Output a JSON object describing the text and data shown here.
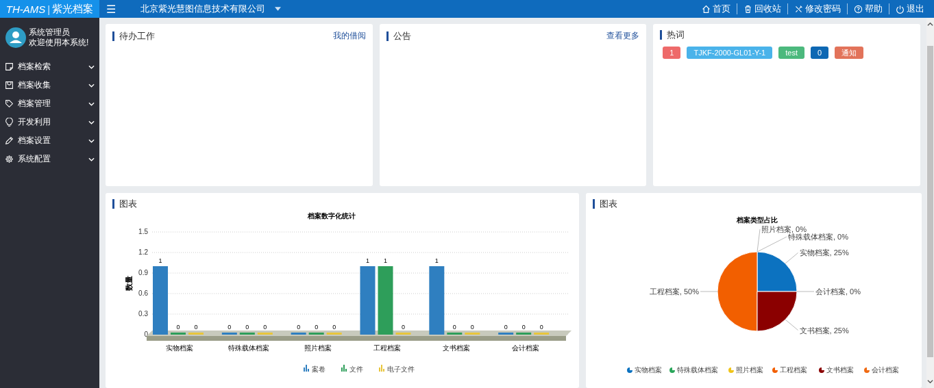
{
  "header": {
    "logo_latin": "TH-AMS",
    "logo_separator": "|",
    "logo_cn": "紫光档案",
    "menu_icon": "☰",
    "organization": "北京紫光慧图信息技术有限公司",
    "nav": [
      {
        "label": "首页"
      },
      {
        "label": "回收站"
      },
      {
        "label": "修改密码"
      },
      {
        "label": "帮助"
      },
      {
        "label": "退出"
      }
    ]
  },
  "sidebar": {
    "user": {
      "name": "系统管理员",
      "greeting": "欢迎使用本系统!"
    },
    "items": [
      {
        "label": "档案检索",
        "expanded": false
      },
      {
        "label": "档案收集",
        "expanded": false
      },
      {
        "label": "档案管理",
        "expanded": false
      },
      {
        "label": "开发利用",
        "expanded": false
      },
      {
        "label": "档案设置",
        "expanded": false
      },
      {
        "label": "系统配置",
        "expanded": false
      }
    ]
  },
  "panels": [
    {
      "title": "待办工作",
      "link": "我的借阅"
    },
    {
      "title": "公告",
      "link": "查看更多"
    },
    {
      "title": "热词",
      "tags": [
        {
          "label": "1",
          "color": "#ee6a6a"
        },
        {
          "label": "TJKF-2000-GL01-Y-1",
          "color": "#4ab3ea"
        },
        {
          "label": "test",
          "color": "#4cb97d"
        },
        {
          "label": "0",
          "color": "#0e68b3"
        },
        {
          "label": "通知",
          "color": "#e2735a"
        }
      ]
    }
  ],
  "bar_panel": {
    "title": "图表",
    "chart_data": {
      "type": "bar",
      "title": "档案数字化统计",
      "ylabel": "数量",
      "categories": [
        "实物档案",
        "特殊载体档案",
        "照片档案",
        "工程档案",
        "文书档案",
        "会计档案"
      ],
      "series": [
        {
          "name": "案卷",
          "color": "#2f7fc0",
          "values": [
            1,
            0,
            0,
            1,
            1,
            0
          ]
        },
        {
          "name": "文件",
          "color": "#2e9e5a",
          "values": [
            0,
            0,
            0,
            1,
            0,
            0
          ]
        },
        {
          "name": "电子文件",
          "color": "#e8c53a",
          "values": [
            0,
            0,
            0,
            0,
            0,
            0
          ]
        }
      ],
      "ylim": [
        0,
        1.5
      ],
      "yticks": [
        0,
        0.3,
        0.6,
        0.9,
        1.2,
        1.5
      ],
      "data_labels": true,
      "grid": true,
      "legend": true
    }
  },
  "pie_panel": {
    "title": "图表",
    "chart_data": {
      "type": "pie",
      "title": "档案类型占比",
      "categories": [
        "实物档案",
        "特殊载体档案",
        "照片档案",
        "工程档案",
        "文书档案",
        "会计档案"
      ],
      "series": [
        {
          "values": [
            25,
            0,
            0,
            50,
            25,
            0
          ]
        }
      ],
      "colors": [
        "#0c72c0",
        "#2aa65a",
        "#f0c419",
        "#f25f00",
        "#8b0000",
        "#f06a12"
      ],
      "value_labels": [
        "实物档案, 25%",
        "特殊载体档案, 0%",
        "照片档案, 0%",
        "工程档案, 50%",
        "文书档案, 25%",
        "会计档案, 0%"
      ],
      "legend": true
    }
  }
}
